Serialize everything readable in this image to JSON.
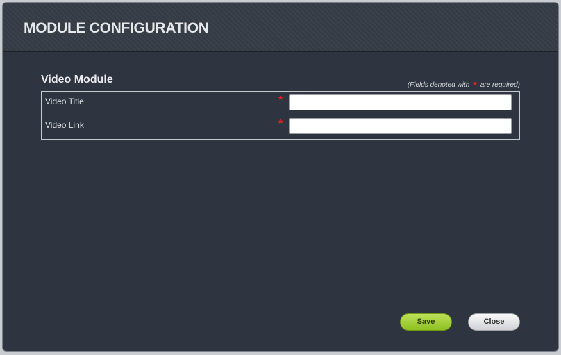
{
  "modal": {
    "title": "MODULE CONFIGURATION"
  },
  "section": {
    "title": "Video Module",
    "required_note_prefix": "(Fields denoted with",
    "required_star": "*",
    "required_note_suffix": "are required)"
  },
  "fields": [
    {
      "label": "Video Title",
      "required_marker": "*",
      "value": "",
      "placeholder": ""
    },
    {
      "label": "Video Link",
      "required_marker": "*",
      "value": "",
      "placeholder": ""
    }
  ],
  "buttons": {
    "save_label": "Save",
    "close_label": "Close"
  },
  "colors": {
    "modal_background": "#2f3540",
    "required_star": "#e02020",
    "save_button": "#a6d03c",
    "close_button": "#e4e5e7"
  }
}
